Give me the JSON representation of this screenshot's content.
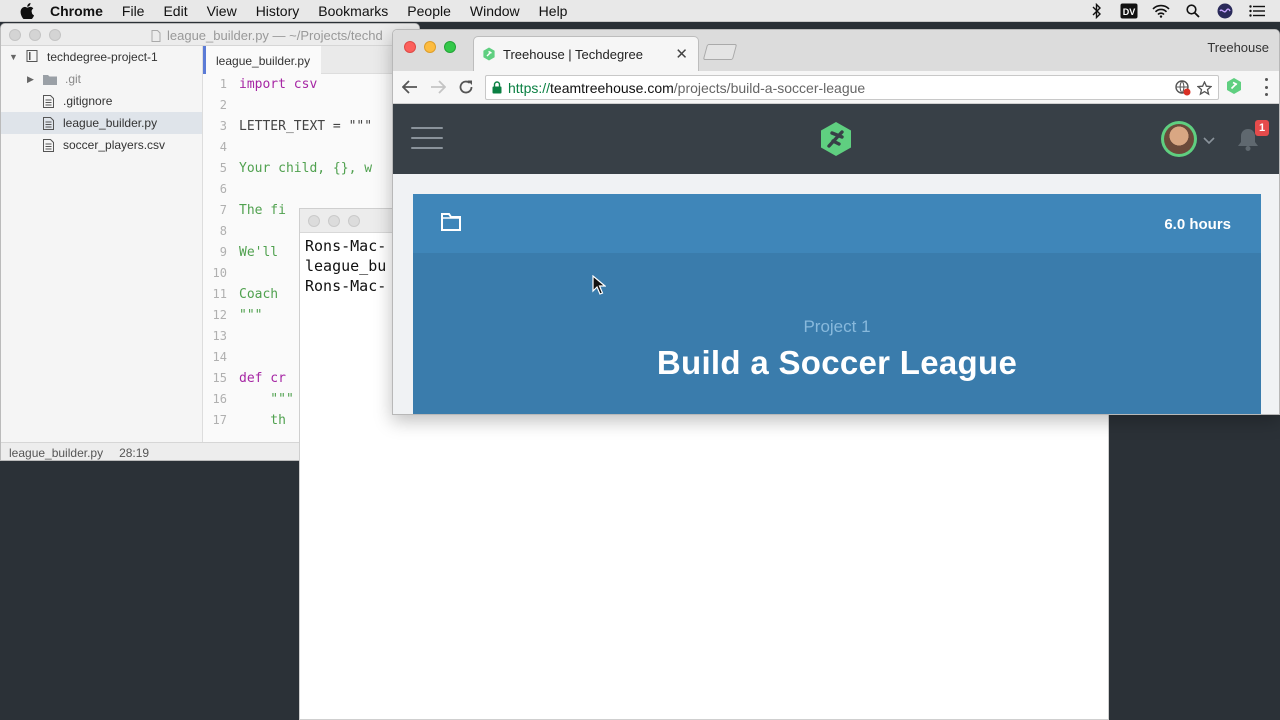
{
  "menubar": {
    "app": "Chrome",
    "items": [
      "File",
      "Edit",
      "View",
      "History",
      "Bookmarks",
      "People",
      "Window",
      "Help"
    ],
    "dv": "DV"
  },
  "editor": {
    "title": "league_builder.py — ~/Projects/techd",
    "tree": {
      "root": "techdegree-project-1",
      "items": [
        ".git",
        ".gitignore",
        "league_builder.py",
        "soccer_players.csv"
      ]
    },
    "tab": "league_builder.py",
    "code": [
      {
        "n": "1",
        "t": "import csv"
      },
      {
        "n": "2",
        "t": ""
      },
      {
        "n": "3",
        "t": "LETTER_TEXT = \"\"\""
      },
      {
        "n": "4",
        "t": ""
      },
      {
        "n": "5",
        "t": "Your child, {}, w"
      },
      {
        "n": "6",
        "t": ""
      },
      {
        "n": "7",
        "t": "The fi"
      },
      {
        "n": "8",
        "t": ""
      },
      {
        "n": "9",
        "t": "We'll"
      },
      {
        "n": "10",
        "t": ""
      },
      {
        "n": "11",
        "t": "Coach"
      },
      {
        "n": "12",
        "t": "\"\"\""
      },
      {
        "n": "13",
        "t": ""
      },
      {
        "n": "14",
        "t": ""
      },
      {
        "n": "15",
        "t": "def cr"
      },
      {
        "n": "16",
        "t": "    \"\"\""
      },
      {
        "n": "17",
        "t": "    th"
      }
    ],
    "status_file": "league_builder.py",
    "status_pos": "28:19"
  },
  "terminal": {
    "lines": [
      "Rons-Mac-",
      "league_bu",
      "Rons-Mac-"
    ]
  },
  "chrome": {
    "tab_title": "Treehouse | Techdegree",
    "profile": "Treehouse",
    "url_scheme": "https://",
    "url_host": "teamtreehouse.com",
    "url_path": "/projects/build-a-soccer-league"
  },
  "site": {
    "notification_count": "1",
    "hours": "6.0 hours",
    "project_label": "Project 1",
    "project_title": "Build a Soccer League"
  }
}
